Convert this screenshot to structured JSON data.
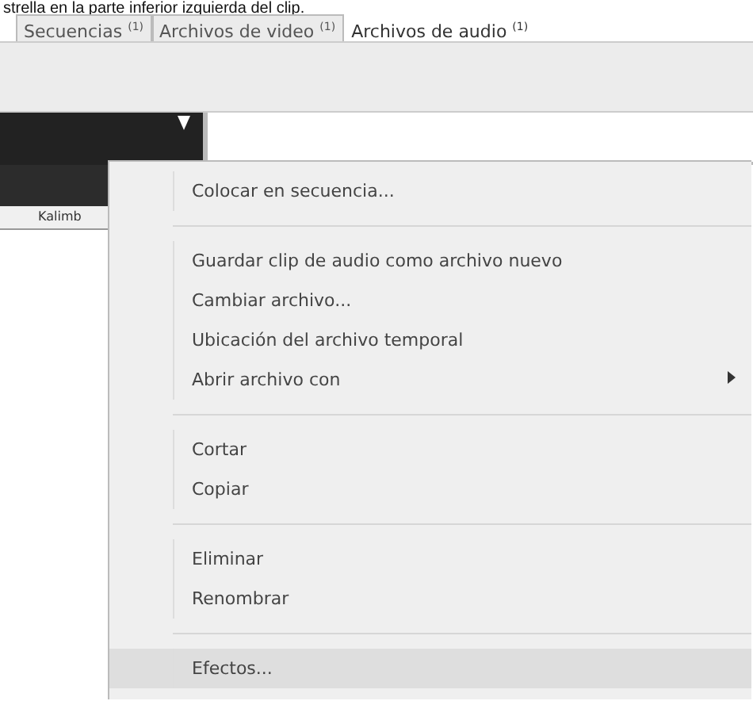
{
  "caption": "strella en la parte inferior izquierda del clip.",
  "tabs": [
    {
      "label": "Secuencias",
      "count": "(1)",
      "selected": false
    },
    {
      "label": "Archivos de video",
      "count": "(1)",
      "selected": false
    },
    {
      "label": "Archivos de audio",
      "count": "(1)",
      "selected": true
    }
  ],
  "clip": {
    "label": "Kalimb"
  },
  "context_menu": {
    "items": [
      {
        "kind": "item",
        "label": "Colocar en secuencia...",
        "submenu": false,
        "selected": false
      },
      {
        "kind": "separator"
      },
      {
        "kind": "item",
        "label": "Guardar clip de audio como archivo nuevo",
        "submenu": false,
        "selected": false
      },
      {
        "kind": "item",
        "label": "Cambiar archivo...",
        "submenu": false,
        "selected": false
      },
      {
        "kind": "item",
        "label": "Ubicación del archivo temporal",
        "submenu": false,
        "selected": false
      },
      {
        "kind": "item",
        "label": "Abrir archivo con",
        "submenu": true,
        "selected": false
      },
      {
        "kind": "separator"
      },
      {
        "kind": "item",
        "label": "Cortar",
        "submenu": false,
        "selected": false
      },
      {
        "kind": "item",
        "label": "Copiar",
        "submenu": false,
        "selected": false
      },
      {
        "kind": "separator"
      },
      {
        "kind": "item",
        "label": "Eliminar",
        "submenu": false,
        "selected": false
      },
      {
        "kind": "item",
        "label": "Renombrar",
        "submenu": false,
        "selected": false
      },
      {
        "kind": "separator"
      },
      {
        "kind": "item",
        "label": "Efectos...",
        "submenu": false,
        "selected": true
      }
    ]
  }
}
